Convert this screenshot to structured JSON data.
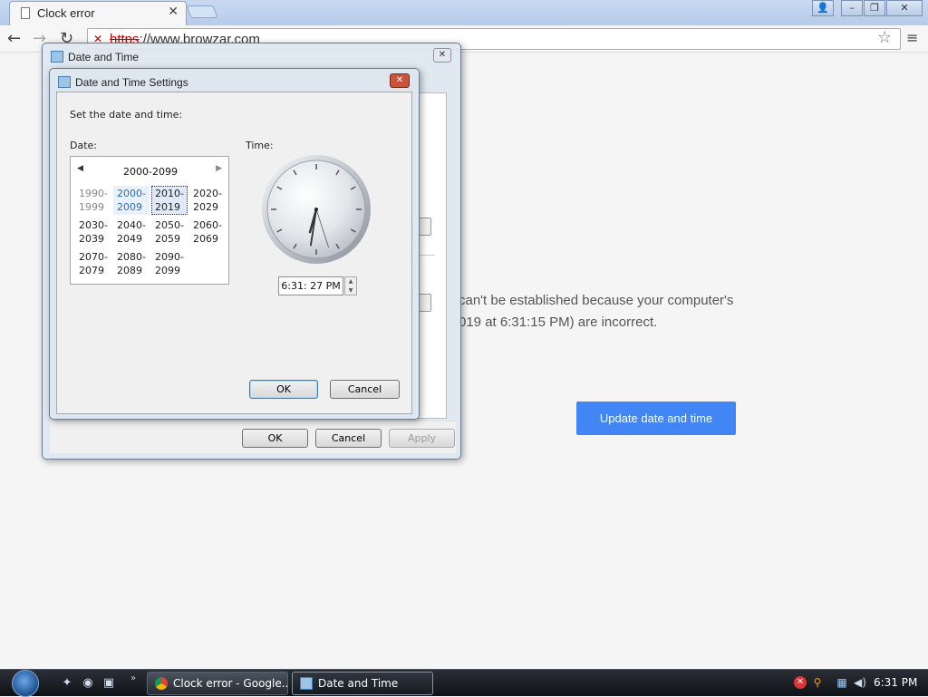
{
  "browser": {
    "tab_title": "Clock error",
    "url_scheme": "https",
    "url_rest": "://www.browzar.com"
  },
  "page": {
    "error_line1": "can't be established because your computer's",
    "error_line2": "019 at 6:31:15 PM) are incorrect.",
    "update_button": "Update date and time",
    "accent_color": "#4285f4"
  },
  "outer_dialog": {
    "title": "Date and Time",
    "ok": "OK",
    "cancel": "Cancel",
    "apply": "Apply"
  },
  "inner_dialog": {
    "title": "Date and Time Settings",
    "prompt": "Set the date and time:",
    "date_label": "Date:",
    "time_label": "Time:",
    "calendar": {
      "header": "2000-2099",
      "decades": [
        {
          "line1": "1990-",
          "line2": "1999",
          "state": "grey"
        },
        {
          "line1": "2000-",
          "line2": "2009",
          "state": "selected"
        },
        {
          "line1": "2010-",
          "line2": "2019",
          "state": "focused"
        },
        {
          "line1": "2020-",
          "line2": "2029",
          "state": "normal"
        },
        {
          "line1": "2030-",
          "line2": "2039",
          "state": "normal"
        },
        {
          "line1": "2040-",
          "line2": "2049",
          "state": "normal"
        },
        {
          "line1": "2050-",
          "line2": "2059",
          "state": "normal"
        },
        {
          "line1": "2060-",
          "line2": "2069",
          "state": "normal"
        },
        {
          "line1": "2070-",
          "line2": "2079",
          "state": "normal"
        },
        {
          "line1": "2080-",
          "line2": "2089",
          "state": "normal"
        },
        {
          "line1": "2090-",
          "line2": "2099",
          "state": "normal"
        }
      ]
    },
    "clock": {
      "hour": 6,
      "minute": 31,
      "second": 27
    },
    "time_value": "6:31: 27 PM",
    "ok": "OK",
    "cancel": "Cancel"
  },
  "taskbar": {
    "tasks": [
      {
        "label": "Clock error - Google...",
        "icon": "chrome-icon"
      },
      {
        "label": "Date and Time",
        "icon": "date-time-icon"
      }
    ],
    "clock": "6:31 PM"
  }
}
